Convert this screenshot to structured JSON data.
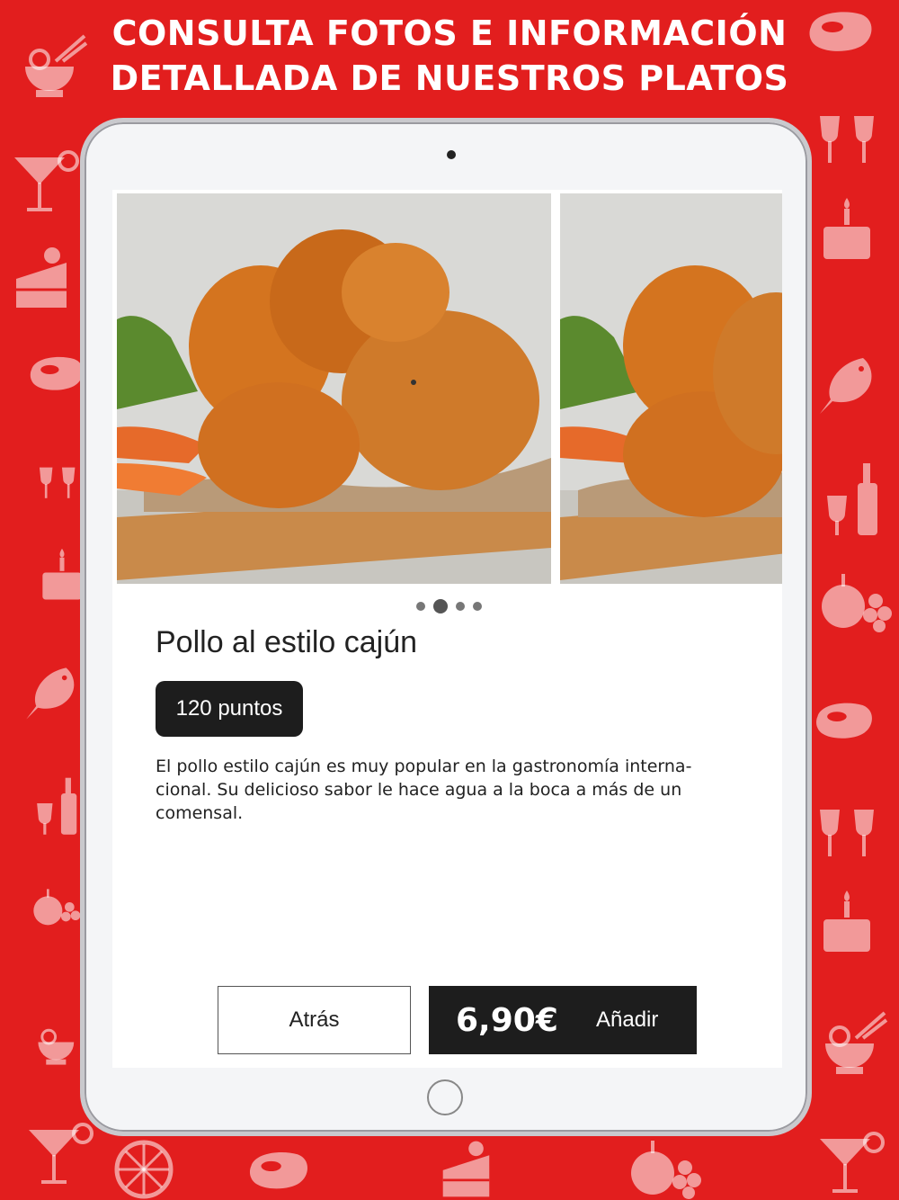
{
  "headline": {
    "line1": "CONSULTA FOTOS E INFORMACIÓN",
    "line2": "DETALLADA DE NUESTROS PLATOS"
  },
  "colors": {
    "background": "#e21e1e",
    "accent_dark": "#1d1d1d"
  },
  "carousel": {
    "page_count": 4,
    "active_index": 1
  },
  "dish": {
    "name": "Pollo al estilo cajún",
    "points": "120 puntos",
    "description": "El pollo estilo cajún es muy popular en la gastronomía interna-cional. Su delicioso sabor le hace agua a la boca a más de un comensal."
  },
  "actions": {
    "back_label": "Atrás",
    "price": "6,90€",
    "add_label": "Añadir"
  },
  "background_icons": [
    "noodles-icon",
    "steak-icon",
    "cocktail-icon",
    "wine-glasses-icon",
    "cake-icon",
    "fish-icon",
    "wine-bottle-icon",
    "fruit-icon",
    "citrus-icon"
  ]
}
